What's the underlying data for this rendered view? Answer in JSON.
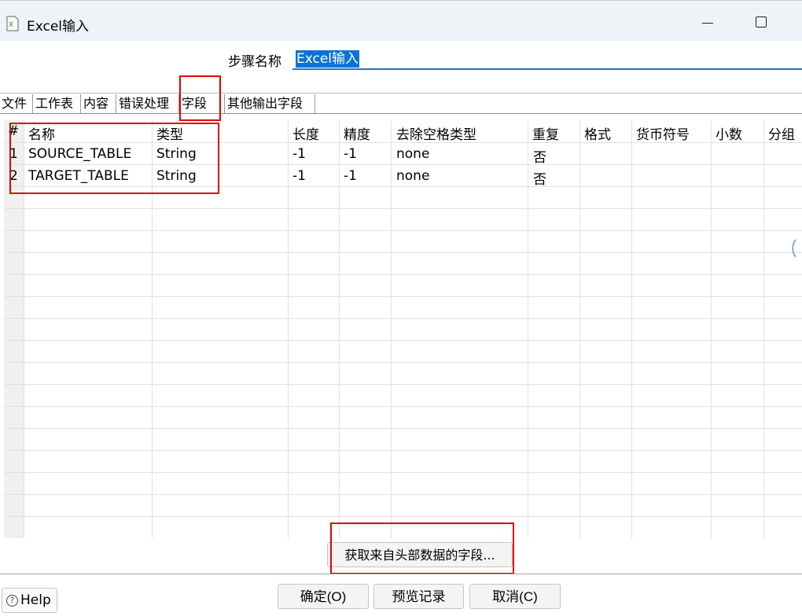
{
  "window": {
    "title": "Excel输入",
    "icon": "excel-input-icon"
  },
  "step": {
    "label": "步骤名称",
    "value": "Excel输入"
  },
  "tabs": [
    "文件",
    "工作表",
    "内容",
    "错误处理",
    "字段",
    "其他输出字段"
  ],
  "active_tab": "字段",
  "table": {
    "columns": [
      "#",
      "名称",
      "类型",
      "长度",
      "精度",
      "去除空格类型",
      "重复",
      "格式",
      "货币符号",
      "小数",
      "分组"
    ],
    "rows": [
      [
        "1",
        "SOURCE_TABLE",
        "String",
        "-1",
        "-1",
        "none",
        "否",
        "",
        "",
        "",
        ""
      ],
      [
        "2",
        "TARGET_TABLE",
        "String",
        "-1",
        "-1",
        "none",
        "否",
        "",
        "",
        "",
        ""
      ]
    ]
  },
  "buttons": {
    "get_fields": "获取来自头部数据的字段...",
    "help": "Help",
    "ok": "确定(O)",
    "preview": "预览记录",
    "cancel": "取消(C)"
  },
  "colors": {
    "highlight": "#e30000",
    "selection": "#0a74d4",
    "accent": "#2a6fc9"
  }
}
